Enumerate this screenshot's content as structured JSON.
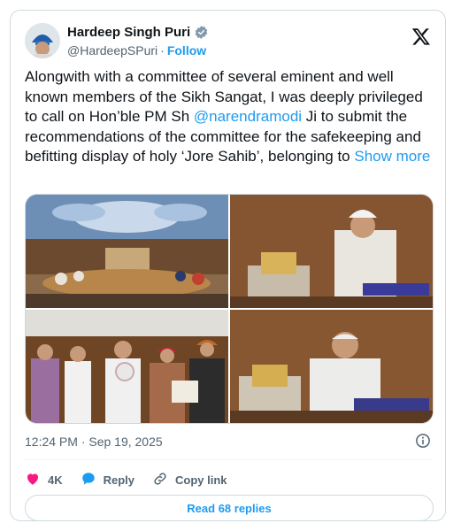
{
  "author": {
    "name": "Hardeep Singh Puri",
    "handle": "@HardeepSPuri",
    "separator": "·",
    "follow_label": "Follow"
  },
  "tweet": {
    "text_part1": "Alongwith with a committee of several eminent and well known members of the Sikh Sangat, I was deeply privileged to call on Hon’ble PM Sh ",
    "mention": "@narendramodi",
    "text_part2": " Ji to submit the recommendations of the committee for the safekeeping and befitting display of holy ‘Jore Sahib’, belonging to ",
    "show_more": "Show more"
  },
  "media": {
    "count": 4
  },
  "meta": {
    "timestamp": "12:24 PM · Sep 19, 2025"
  },
  "actions": {
    "likes": "4K",
    "reply_label": "Reply",
    "copy_link_label": "Copy link"
  },
  "read_replies_label": "Read 68 replies",
  "colors": {
    "accent": "#1d9bf0",
    "like": "#f91880",
    "text": "#0f1419",
    "muted": "#536471"
  }
}
